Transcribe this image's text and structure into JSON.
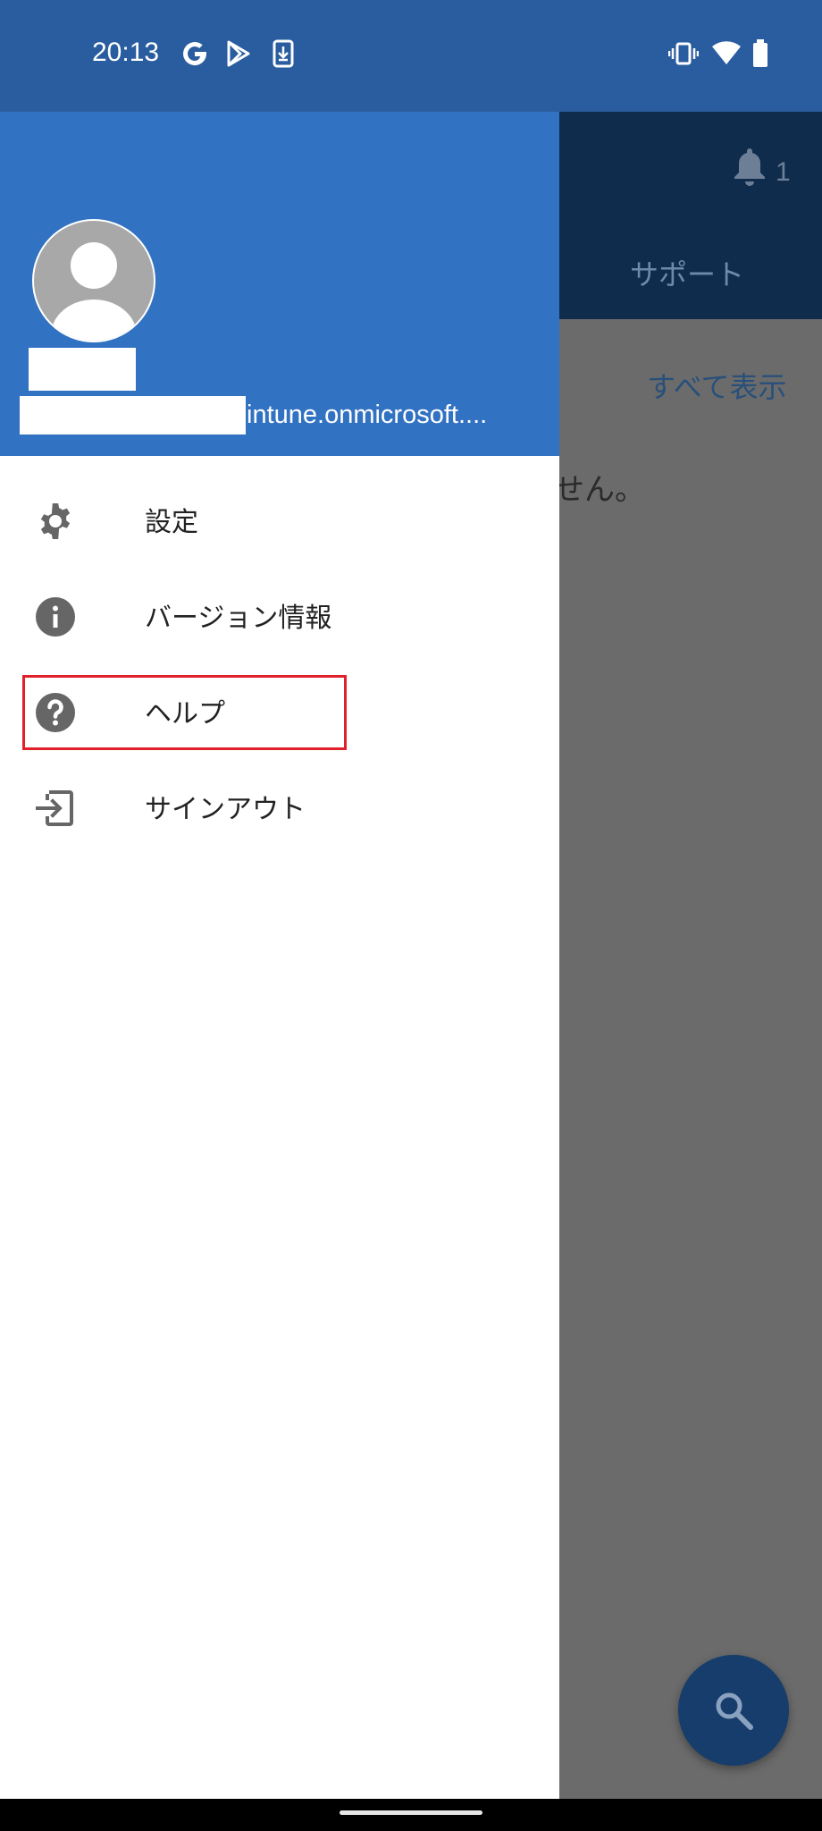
{
  "status_bar": {
    "time": "20:13",
    "left_icons": [
      "google-icon",
      "play-store-icon",
      "download-icon"
    ],
    "right_icons": [
      "vibrate-icon",
      "wifi-icon",
      "battery-icon"
    ]
  },
  "background_app": {
    "notification_count": "1",
    "support_tab_label": "サポート",
    "see_all_label": "すべて表示",
    "partial_message": "せん。",
    "fab_icon": "search-icon"
  },
  "drawer": {
    "email_suffix": "intune.onmicrosoft....",
    "menu": [
      {
        "label": "設定",
        "icon": "gear-icon"
      },
      {
        "label": "バージョン情報",
        "icon": "info-icon"
      },
      {
        "label": "ヘルプ",
        "icon": "help-icon",
        "highlighted": true
      },
      {
        "label": "サインアウト",
        "icon": "sign-out-icon"
      }
    ]
  },
  "colors": {
    "status_bar": "#2a5d9f",
    "drawer_header": "#3272c2",
    "app_header_dimmed": "#102c4d",
    "scrim": "#6b6b6b",
    "highlight": "#e0202a"
  }
}
